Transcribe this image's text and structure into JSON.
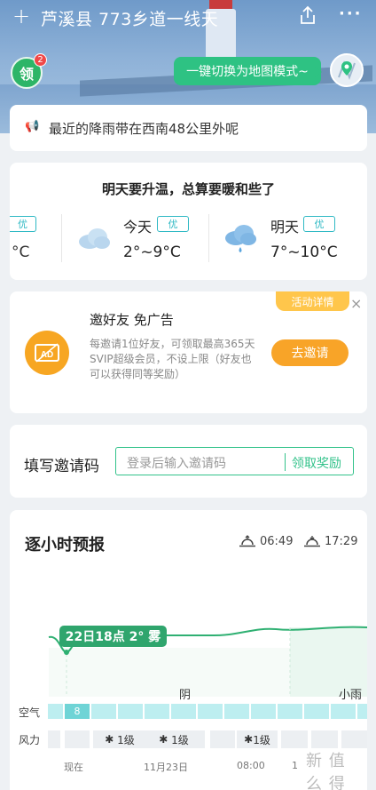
{
  "header": {
    "title": "芦溪县 773乡道一线天",
    "plus_glyph": "+",
    "more_glyph": "···"
  },
  "ling": {
    "label": "领",
    "badge": "2"
  },
  "map_switch": {
    "label": "一键切换为地图模式~"
  },
  "rain_notice": {
    "text": "最近的降雨带在西南48公里外呢"
  },
  "forecast": {
    "headline": "明天要升温，总算要暖和些了",
    "partial": {
      "badge": "优",
      "temp": "°C"
    },
    "days": [
      {
        "label": "今天",
        "badge": "优",
        "temp": "2°~9°C",
        "icon": "cloud-icon"
      },
      {
        "label": "明天",
        "badge": "优",
        "temp": "7°~10°C",
        "icon": "cloud-rain-icon"
      }
    ]
  },
  "invite": {
    "tag": "活动详情",
    "close": "×",
    "icon_text": "AD",
    "title": "邀好友 免广告",
    "desc": "每邀请1位好友，可领取最高365天SVIP超级会员，不设上限（好友也可以获得同等奖励）",
    "button": "去邀请"
  },
  "invite_code": {
    "label": "填写邀请码",
    "placeholder": "登录后输入邀请码",
    "button": "领取奖励"
  },
  "hourly": {
    "title": "逐小时预报",
    "sunrise": "06:49",
    "sunset": "17:29",
    "tooltip": "22日18点 2° 雾",
    "conditions": [
      "阴",
      "小雨"
    ],
    "air_label": "空气",
    "air_value": "8",
    "wind_label": "风力",
    "wind_values": [
      "1级",
      "1级",
      "1级"
    ],
    "time_labels": [
      "现在",
      "11月23日",
      "08:00",
      "1"
    ]
  },
  "watermark": "新 值 么 得 买",
  "colors": {
    "accent": "#2ec283",
    "aqi": "#2fb9c4",
    "orange": "#f8a428"
  }
}
